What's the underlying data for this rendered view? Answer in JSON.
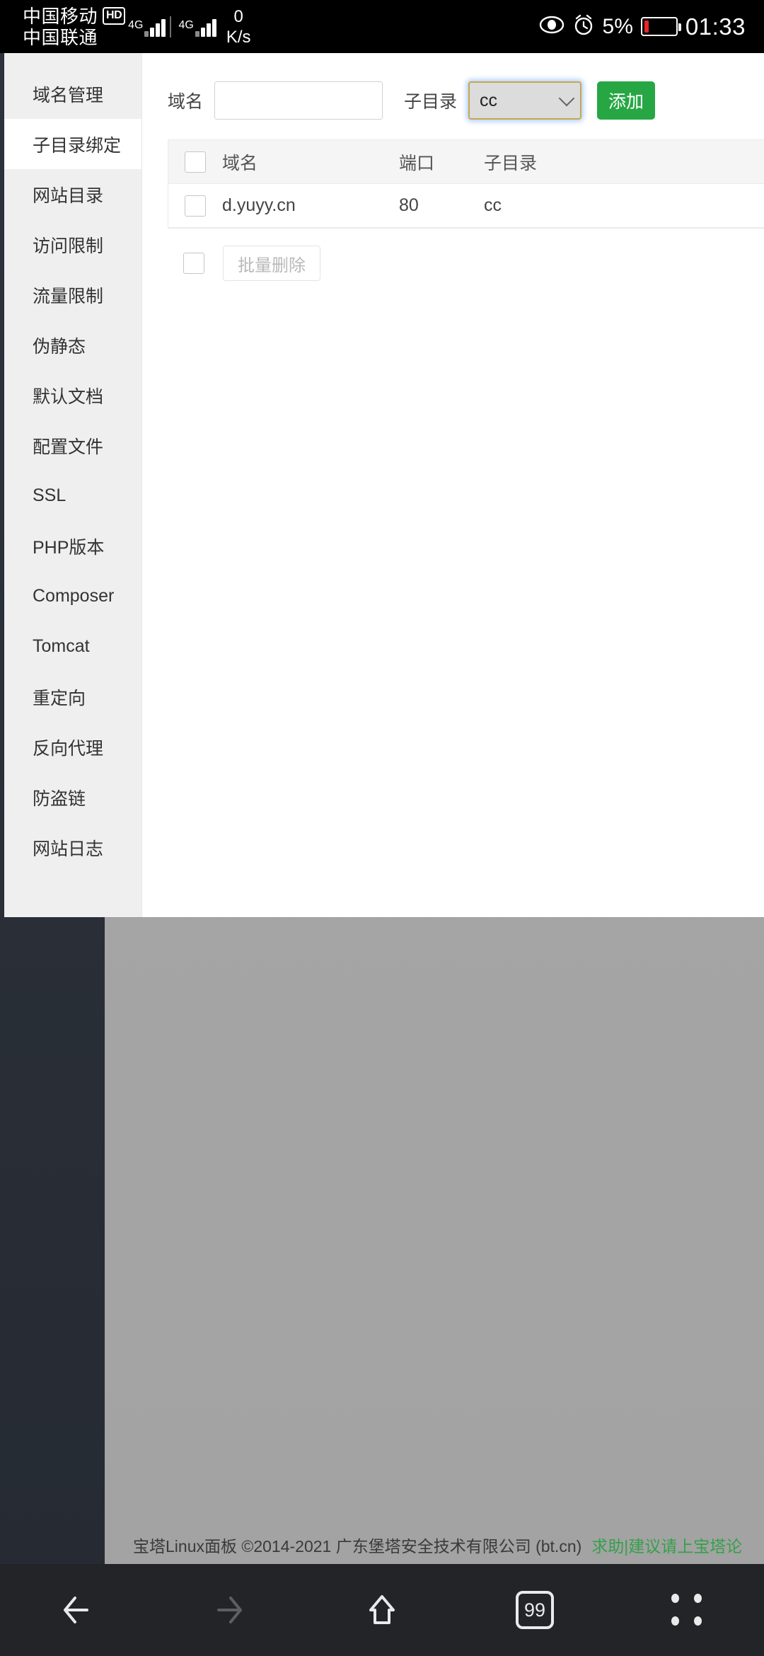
{
  "statusbar": {
    "carrier1": "中国移动",
    "hd_badge": "HD",
    "carrier2": "中国联通",
    "net_type_1": "4G",
    "net_type_2": "4G",
    "net_speed_value": "0",
    "net_speed_unit": "K/s",
    "battery_percent": "5%",
    "clock": "01:33"
  },
  "sidebar": {
    "items": [
      {
        "label": "域名管理",
        "active": false
      },
      {
        "label": "子目录绑定",
        "active": true
      },
      {
        "label": "网站目录",
        "active": false
      },
      {
        "label": "访问限制",
        "active": false
      },
      {
        "label": "流量限制",
        "active": false
      },
      {
        "label": "伪静态",
        "active": false
      },
      {
        "label": "默认文档",
        "active": false
      },
      {
        "label": "配置文件",
        "active": false
      },
      {
        "label": "SSL",
        "active": false
      },
      {
        "label": "PHP版本",
        "active": false
      },
      {
        "label": "Composer",
        "active": false
      },
      {
        "label": "Tomcat",
        "active": false
      },
      {
        "label": "重定向",
        "active": false
      },
      {
        "label": "反向代理",
        "active": false
      },
      {
        "label": "防盗链",
        "active": false
      },
      {
        "label": "网站日志",
        "active": false
      }
    ]
  },
  "form": {
    "domain_label": "域名",
    "domain_value": "",
    "domain_placeholder": "",
    "subdir_label": "子目录",
    "subdir_selected": "cc",
    "subdir_options": [
      "cc"
    ],
    "add_button": "添加"
  },
  "table": {
    "headers": {
      "domain": "域名",
      "port": "端口",
      "subdir": "子目录"
    },
    "rows": [
      {
        "domain": "d.yuyy.cn",
        "port": "80",
        "subdir": "cc"
      }
    ],
    "bulk_delete_label": "批量删除"
  },
  "footer": {
    "text": "宝塔Linux面板 ©2014-2021 广东堡塔安全技术有限公司 (bt.cn)",
    "link": "求助|建议请上宝塔论",
    "link_color": "#35a04a"
  },
  "navbar": {
    "back": "back-arrow",
    "forward": "forward-arrow",
    "home": "home-arrow",
    "tabs_count": "99",
    "menu": "menu-dots"
  },
  "colors": {
    "accent_green": "#27a744",
    "focus_gold": "#c8a64d",
    "battery_red": "#e8252a"
  }
}
